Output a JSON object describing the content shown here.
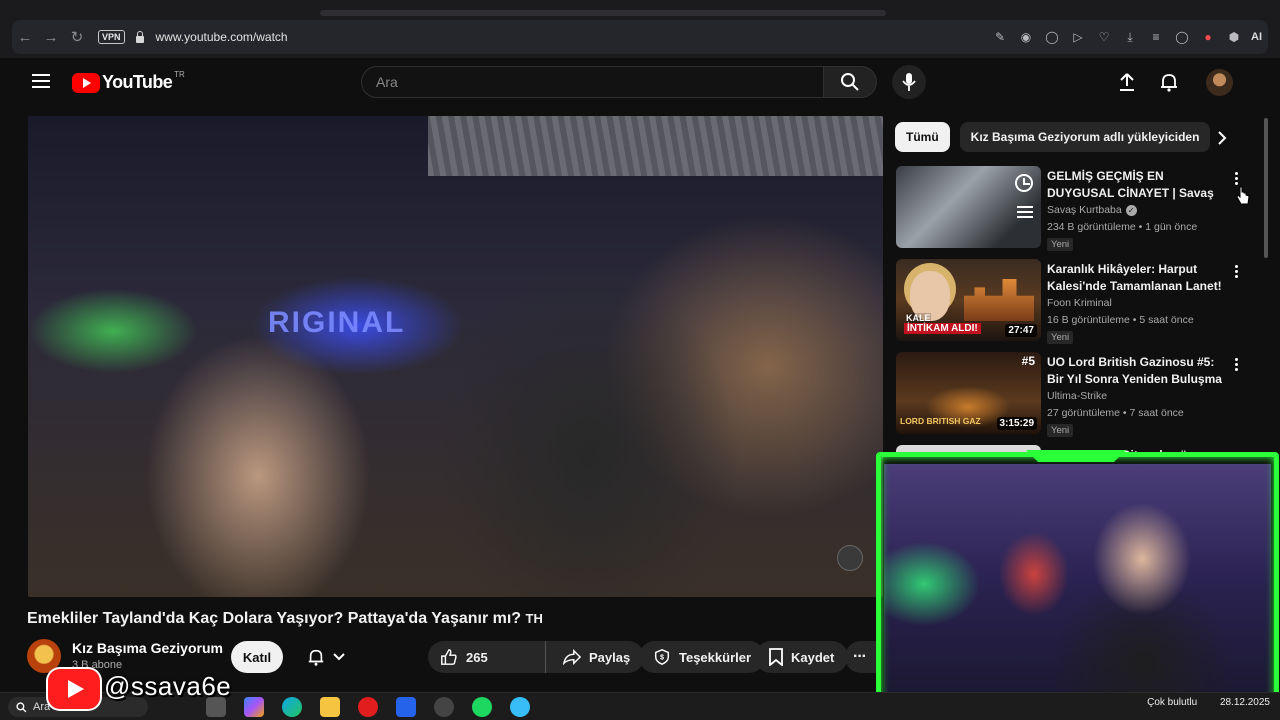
{
  "browser": {
    "vpn_label": "VPN",
    "url": "www.youtube.com/watch",
    "ai_label": "AI"
  },
  "header": {
    "logo_text": "YouTube",
    "country": "TR",
    "search_placeholder": "Ara"
  },
  "video": {
    "sign_text": "RIGINAL",
    "title": "Emekliler Tayland'da Kaç Dolara Yaşıyor? Pattaya'da Yaşanır mı?",
    "title_suffix": "TH",
    "channel_name": "Kız Başıma Geziyorum",
    "subscribers": "3 B abone",
    "join_label": "Katıl",
    "likes": "265",
    "share_label": "Paylaş",
    "thanks_label": "Teşekkürler",
    "save_label": "Kaydet"
  },
  "sidebar": {
    "chips": [
      "Tümü",
      "Kız Başıma Geziyorum adlı yükleyiciden"
    ],
    "recommendations": [
      {
        "title": "GELMİŞ GEÇMİŞ EN DUYGUSAL CİNAYET | Savaş Kurtbaba ile ...",
        "channel": "Savaş Kurtbaba",
        "verified": true,
        "meta": "234 B görüntüleme • 1 gün önce",
        "badge": "Yeni",
        "duration": ""
      },
      {
        "title": "Karanlık Hikâyeler: Harput Kalesi'nde Tamamlanan Lanet!",
        "channel": "Foon Kriminal",
        "verified": false,
        "meta": "16 B görüntüleme • 5 saat önce",
        "badge": "Yeni",
        "duration": "27:47",
        "thumb_text_1": "KALE",
        "thumb_text_2": "İNTİKAM ALDI!"
      },
      {
        "title": "UO Lord British Gazinosu #5: Bir Yıl Sonra Yeniden Buluşma",
        "channel": "Ultima-Strike",
        "verified": false,
        "meta": "27 görüntüleme • 7 saat önce",
        "badge": "Yeni",
        "duration": "3:15:29",
        "thumb_text_1": "LORD BRITISH GAZ",
        "thumb_text_2": "#5"
      },
      {
        "title": "TANZANYA - Gitmeden önce ...",
        "channel": "",
        "verified": false,
        "meta": "",
        "badge": "",
        "duration": ""
      }
    ]
  },
  "overlay": {
    "handle": "@ssava6e"
  },
  "taskbar": {
    "search_label": "Ara",
    "date": "28.12.2025",
    "weather": "Çok bulutlu"
  },
  "colors": {
    "yt_red": "#ff0000",
    "webcam_frame": "#2bff3a",
    "background": "#0f0f0f"
  }
}
